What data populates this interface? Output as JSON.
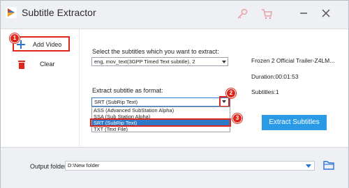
{
  "window": {
    "title": "Subtitle Extractor"
  },
  "sidebar": {
    "add_label": "Add Video",
    "clear_label": "Clear"
  },
  "main": {
    "select_prompt": "Select the subtitles which you want to extract:",
    "subtitle_track_value": "eng, mov_text(3GPP Timed Text subtitle), 2",
    "format_prompt": "Extract subtitle as format:",
    "format_value": "SRT (SubRip Text)",
    "format_options": [
      "ASS (Advanced SubStation Alpha)",
      "SSA (Sub Station Alpha)",
      "SRT (SubRip Text)",
      "TXT (Text File)"
    ],
    "selected_option_index": 2
  },
  "info": {
    "filename": "Frozen 2 Official Trailer-Z4LM...",
    "duration": "Duration:00:01:53",
    "subtitles": "Subtitles:1"
  },
  "extract_button": "Extract Subtitles",
  "output": {
    "label": "Output folder:",
    "path": "D:\\New folder"
  },
  "badges": [
    "1",
    "2",
    "3"
  ],
  "colors": {
    "accent_red": "#e0261a",
    "button_blue": "#2a9ae6",
    "selection_blue": "#2e79c9"
  }
}
